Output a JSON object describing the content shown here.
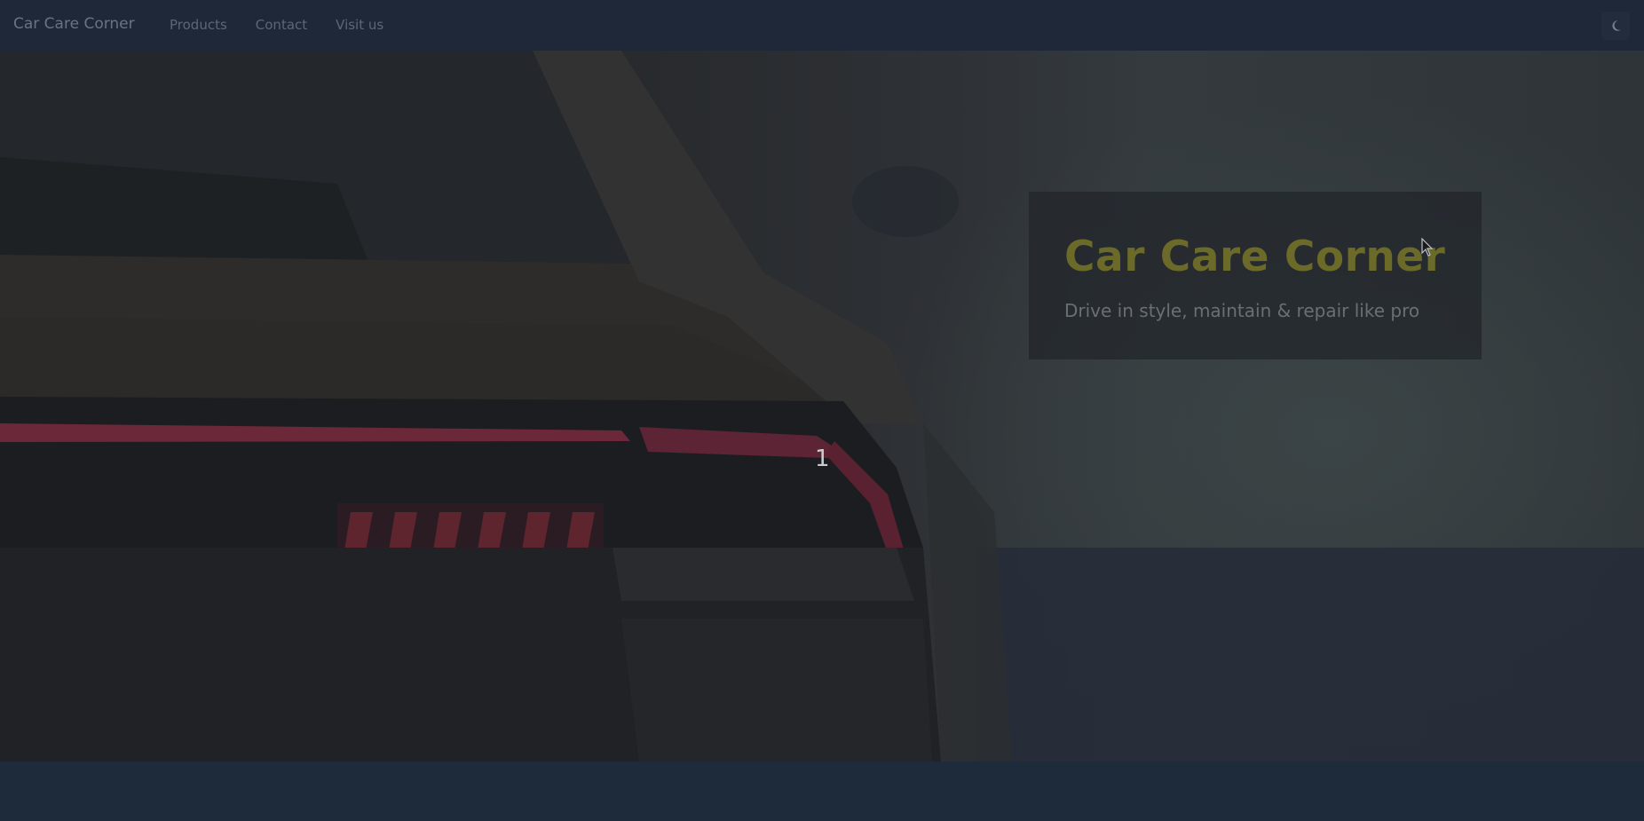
{
  "navbar": {
    "brand": "Car Care Corner",
    "links": [
      {
        "label": "Products"
      },
      {
        "label": "Contact"
      },
      {
        "label": "Visit us"
      }
    ],
    "theme_toggle_icon": "moon-icon"
  },
  "hero": {
    "slide_number": "1",
    "caption_title": "Car Care Corner",
    "caption_subtitle": "Drive in style, maintain & repair like pro",
    "caption_title_color": "#6b6a28",
    "background_image": "car-taillight-photo"
  }
}
